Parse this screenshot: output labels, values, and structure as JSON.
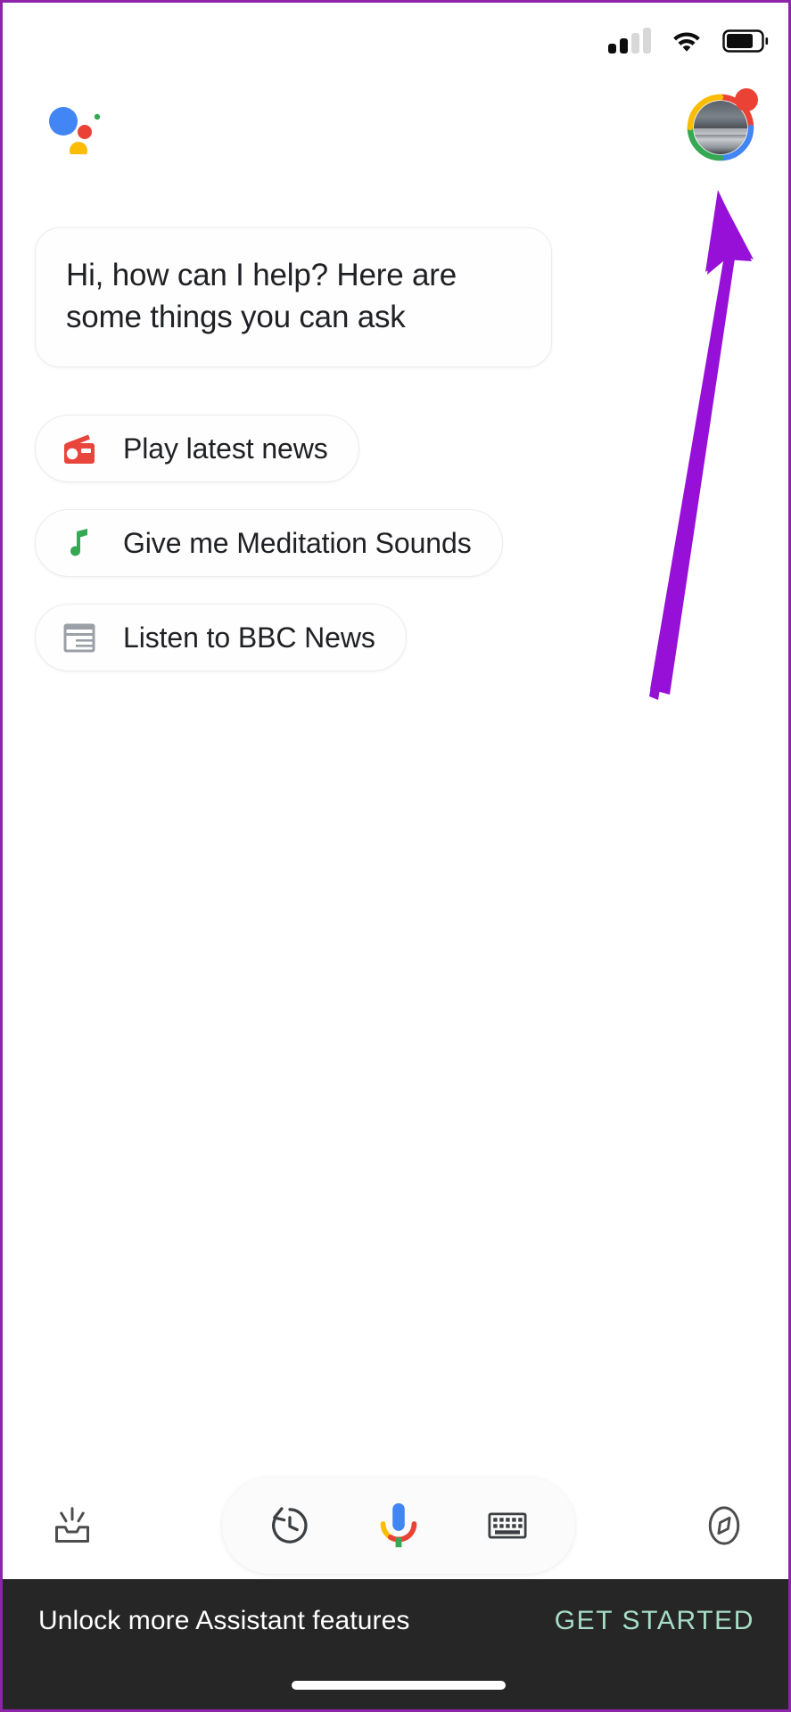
{
  "app": {
    "name": "Google Assistant",
    "logo_icon": "google-assistant-logo-icon"
  },
  "status_bar": {
    "signal_icon": "cellular-signal-icon",
    "signal_bars_total": 4,
    "signal_bars_active": 2,
    "wifi_icon": "wifi-icon",
    "battery_icon": "battery-icon",
    "battery_level_percent": 75
  },
  "header": {
    "avatar_icon": "profile-avatar",
    "avatar_ring_colors": [
      "#ea4335",
      "#4285f4",
      "#34a853",
      "#fbbc04"
    ],
    "avatar_notification_dot_color": "#ea4335",
    "notification_dot_icon": "notification-dot-icon"
  },
  "greeting": {
    "text": "Hi, how can I help? Here are some things you can ask"
  },
  "suggestions": [
    {
      "label": "Play latest news",
      "icon": "radio-icon",
      "icon_color": "#e8453c"
    },
    {
      "label": "Give me Meditation Sounds",
      "icon": "music-note-icon",
      "icon_color": "#34a853"
    },
    {
      "label": "Listen to BBC News",
      "icon": "newspaper-icon",
      "icon_color": "#9aa0a6"
    }
  ],
  "annotation": {
    "type": "arrow",
    "color": "#9610d8",
    "points_to": "profile-avatar"
  },
  "bottom_toolbar": {
    "snapshot_icon": "snapshot-inbox-icon",
    "history_icon": "history-clock-icon",
    "mic_icon": "google-microphone-icon",
    "keyboard_icon": "keyboard-icon",
    "explore_icon": "explore-compass-icon"
  },
  "snackbar": {
    "message": "Unlock more Assistant features",
    "action_label": "GET STARTED",
    "action_color": "#a8ddc8",
    "background_color": "#262626"
  }
}
